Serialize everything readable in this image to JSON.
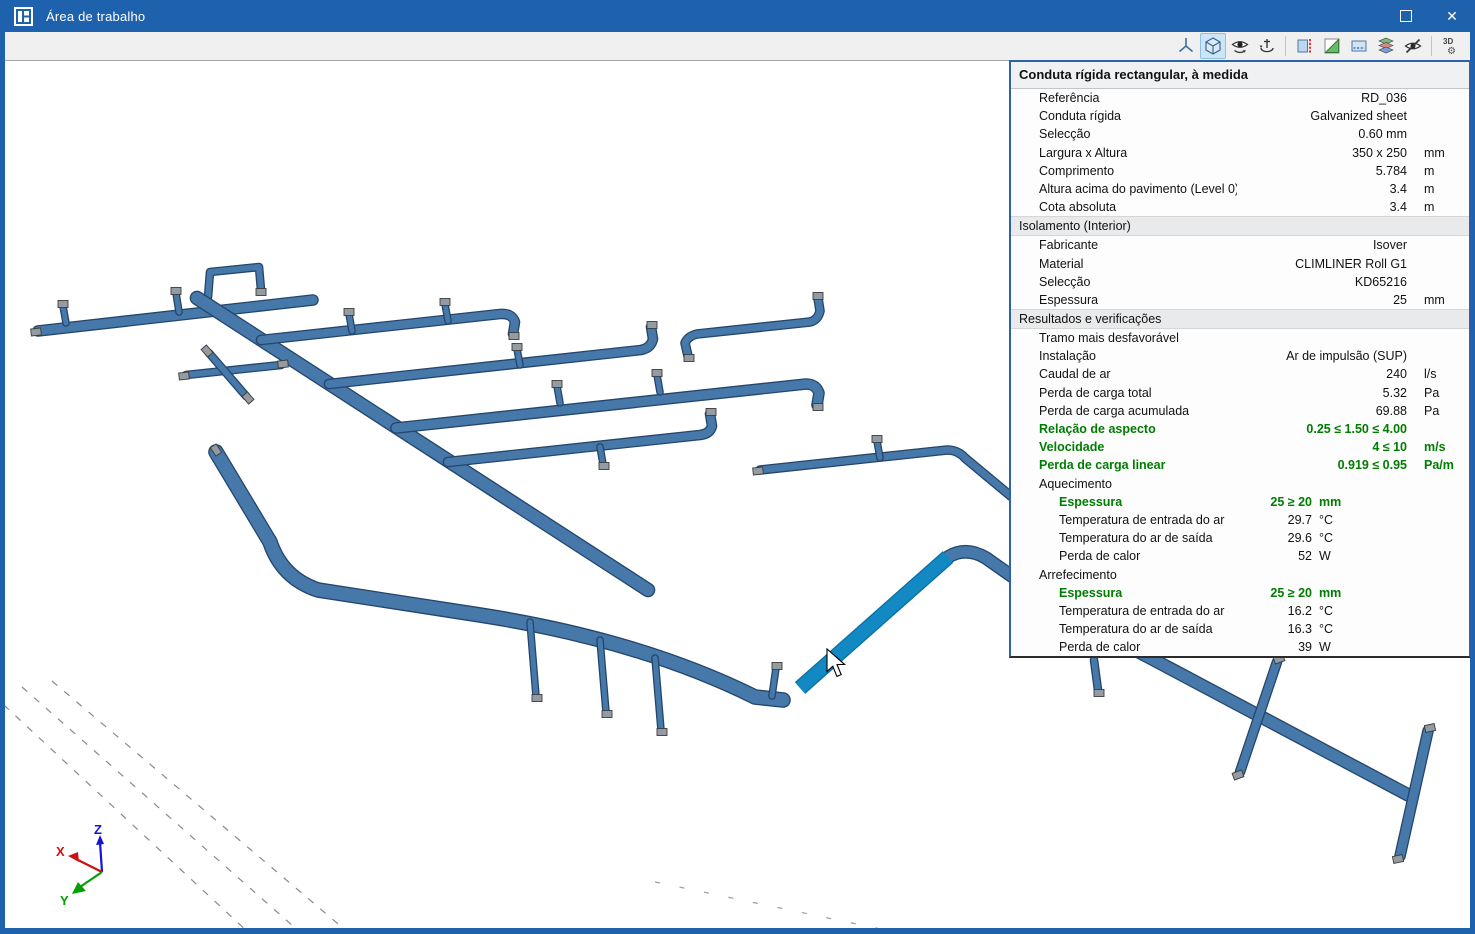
{
  "window": {
    "title": "Área de trabalho",
    "close_glyph": "✕"
  },
  "toolbar": {
    "buttons": [
      {
        "name": "axes-icon",
        "active": false,
        "sep_before": false
      },
      {
        "name": "view-cube-icon",
        "active": true,
        "sep_before": false
      },
      {
        "name": "orbit-view-icon",
        "active": false,
        "sep_before": false
      },
      {
        "name": "turntable-rotate-icon",
        "active": false,
        "sep_before": false
      },
      {
        "name": "section-plane-icon",
        "active": false,
        "sep_before": true
      },
      {
        "name": "slope-plane-icon",
        "active": false,
        "sep_before": false
      },
      {
        "name": "work-plane-icon",
        "active": false,
        "sep_before": false
      },
      {
        "name": "layers-icon",
        "active": false,
        "sep_before": false
      },
      {
        "name": "hide-elements-icon",
        "active": false,
        "sep_before": false
      },
      {
        "name": "view-3d-settings-icon",
        "active": false,
        "sep_before": true,
        "label": "3D"
      }
    ]
  },
  "panel": {
    "title": "Conduta rígida rectangular, à medida",
    "sections": [
      {
        "header": null,
        "rows": [
          {
            "label": "Referência",
            "value": "RD_036",
            "unit": "",
            "style": "n",
            "sub": false
          },
          {
            "label": "Conduta rígida",
            "value": "Galvanized sheet",
            "unit": "",
            "style": "n",
            "sub": false
          },
          {
            "label": "Selecção",
            "value": "0.60 mm",
            "unit": "",
            "style": "n",
            "sub": false
          },
          {
            "label": "Largura x Altura",
            "value": "350 x 250",
            "unit": "mm",
            "style": "n",
            "sub": false
          },
          {
            "label": "Comprimento",
            "value": "5.784",
            "unit": "m",
            "style": "n",
            "sub": false
          },
          {
            "label": "Altura acima do pavimento (Level 0)",
            "value": "3.4",
            "unit": "m",
            "style": "n",
            "sub": false
          },
          {
            "label": "Cota absoluta",
            "value": "3.4",
            "unit": "m",
            "style": "n",
            "sub": false
          }
        ]
      },
      {
        "header": "Isolamento (Interior)",
        "rows": [
          {
            "label": "Fabricante",
            "value": "Isover",
            "unit": "",
            "style": "n",
            "sub": false
          },
          {
            "label": "Material",
            "value": "CLIMLINER Roll G1",
            "unit": "",
            "style": "n",
            "sub": false
          },
          {
            "label": "Selecção",
            "value": "KD65216",
            "unit": "",
            "style": "n",
            "sub": false
          },
          {
            "label": "Espessura",
            "value": "25",
            "unit": "mm",
            "style": "n",
            "sub": false
          }
        ]
      },
      {
        "header": "Resultados e verificações",
        "rows": [
          {
            "label": "Tramo mais desfavorável",
            "value": "",
            "unit": "",
            "style": "n",
            "sub": false
          },
          {
            "label": "Instalação",
            "value": "Ar de impulsão (SUP)",
            "unit": "",
            "style": "n",
            "sub": false
          },
          {
            "label": "Caudal de ar",
            "value": "240",
            "unit": "l/s",
            "style": "n",
            "sub": false
          },
          {
            "label": "Perda de carga total",
            "value": "5.32",
            "unit": "Pa",
            "style": "n",
            "sub": false
          },
          {
            "label": "Perda de carga acumulada",
            "value": "69.88",
            "unit": "Pa",
            "style": "n",
            "sub": false
          },
          {
            "label": "Relação de aspecto",
            "value": "0.25 ≤ 1.50 ≤ 4.00",
            "unit": "",
            "style": "g",
            "sub": false
          },
          {
            "label": "Velocidade",
            "value": "4 ≤ 10",
            "unit": "m/s",
            "style": "g",
            "sub": false
          },
          {
            "label": "Perda de carga linear",
            "value": "0.919 ≤ 0.95",
            "unit": "Pa/m",
            "style": "g",
            "sub": false
          },
          {
            "label": "Aquecimento",
            "value": "",
            "unit": "",
            "style": "n",
            "sub": false
          },
          {
            "label": "Espessura",
            "value": "25 ≥ 20",
            "unit": "mm",
            "style": "g",
            "sub": true
          },
          {
            "label": "Temperatura de entrada do ar",
            "value": "29.7",
            "unit": "°C",
            "style": "n",
            "sub": true
          },
          {
            "label": "Temperatura do ar de saída",
            "value": "29.6",
            "unit": "°C",
            "style": "n",
            "sub": true
          },
          {
            "label": "Perda de calor",
            "value": "52",
            "unit": "W",
            "style": "n",
            "sub": true
          },
          {
            "label": "Arrefecimento",
            "value": "",
            "unit": "",
            "style": "n",
            "sub": false
          },
          {
            "label": "Espessura",
            "value": "25 ≥ 20",
            "unit": "mm",
            "style": "g",
            "sub": true
          },
          {
            "label": "Temperatura de entrada do ar",
            "value": "16.2",
            "unit": "°C",
            "style": "n",
            "sub": true
          },
          {
            "label": "Temperatura do ar de saída",
            "value": "16.3",
            "unit": "°C",
            "style": "n",
            "sub": true
          },
          {
            "label": "Perda de calor",
            "value": "39",
            "unit": "W",
            "style": "n",
            "sub": true
          }
        ]
      }
    ]
  },
  "axis": {
    "x": "X",
    "y": "Y",
    "z": "Z"
  },
  "colors": {
    "titlebar_blue": "#1e62ae",
    "duct_blue": "#4678aa",
    "duct_outline": "#24466b",
    "highlight_cyan": "#1389c4",
    "highlight_outline": "#0a6fa5",
    "ok_green": "#007d00"
  }
}
